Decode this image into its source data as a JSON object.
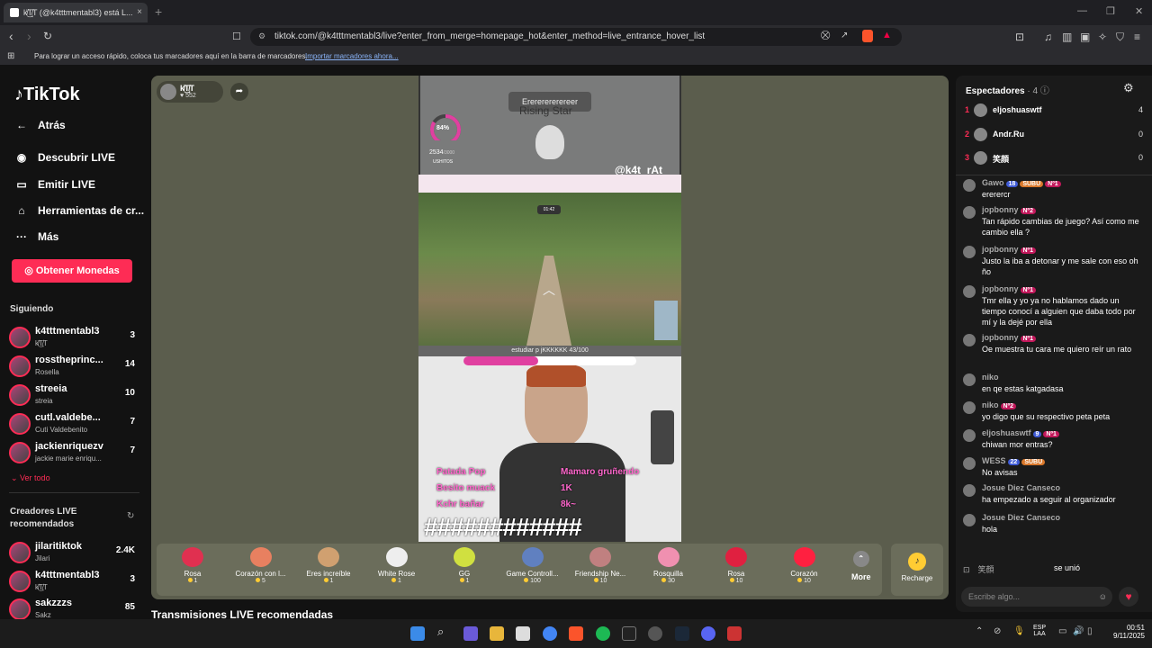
{
  "browser": {
    "tab_title": "k̸̈͜T̸͙T (@k4tttmentabl3) está L...",
    "tab_close": "×",
    "new_tab": "+",
    "url": "tiktok.com/@k4tttmentabl3/live?enter_from_merge=homepage_hot&enter_method=live_entrance_hover_list",
    "bookmarks_text": "Para lograr un acceso rápido, coloca tus marcadores aquí en la barra de marcadores.",
    "bookmarks_link": "Importar marcadores ahora..."
  },
  "sidebar": {
    "logo": "TikTok",
    "back": "Atrás",
    "nav": [
      {
        "label": "Descubrir LIVE",
        "icon": "live-discover-icon"
      },
      {
        "label": "Emitir LIVE",
        "icon": "camera-icon"
      },
      {
        "label": "Herramientas de cr...",
        "icon": "home-icon"
      },
      {
        "label": "Más",
        "icon": "more-dots-icon"
      }
    ],
    "coins_button": "Obtener Monedas",
    "following_title": "Siguiendo",
    "following": [
      {
        "name": "k4tttmentabl3",
        "sub": "k̸̈͜T̸͙T",
        "count": "3"
      },
      {
        "name": "rosstheprinc...",
        "sub": "Rosella",
        "count": "14"
      },
      {
        "name": "streeia",
        "sub": "streia",
        "count": "10"
      },
      {
        "name": "cutl.valdebe...",
        "sub": "Cuti Valdebenito",
        "count": "7"
      },
      {
        "name": "jackienriquezv",
        "sub": "jackie marie enriqu...",
        "count": "7"
      }
    ],
    "see_all": "Ver todo",
    "recommended_title": "Creadores LIVE recomendados",
    "recommended": [
      {
        "name": "jilaritiktok",
        "sub": "Jilari",
        "count": "2.4K"
      },
      {
        "name": "k4tttmentabl3",
        "sub": "k̸̈͜T̸͙T",
        "count": "3"
      },
      {
        "name": "sakzzzs",
        "sub": "Sakz",
        "count": "85"
      }
    ]
  },
  "stage": {
    "streamer_name": "k̸̈͜T̸͙T",
    "streamer_likes": "552",
    "overlay": {
      "banner_text": "Erererererereer",
      "banner_sub": "Rising Star",
      "gauge_percent": "84%",
      "gauge_count": "2534",
      "gauge_total": "/3000",
      "gauge_label": "USHITOS",
      "handle": "@k4t_rAt",
      "map_time": "01:42",
      "goal_text": "estudiar p jKKKKKK 43/100",
      "goal_percent": "43%",
      "goal_progress": 0.43,
      "gauge_progress": 0.84,
      "actions": [
        "Patada Pop",
        "Besito muack",
        "Kchr bañar",
        "Mamaro gruñendo",
        "1K",
        "8k~"
      ],
      "hashes": "############"
    },
    "gifts": [
      {
        "name": "Rosa",
        "price": "1",
        "color": "#e03050"
      },
      {
        "name": "Corazón con l...",
        "price": "5",
        "color": "#e88060"
      },
      {
        "name": "Eres increíble",
        "price": "1",
        "color": "#d0a070"
      },
      {
        "name": "White Rose",
        "price": "1",
        "color": "#eeeeee"
      },
      {
        "name": "GG",
        "price": "1",
        "color": "#d0e040"
      },
      {
        "name": "Game Controll...",
        "price": "100",
        "color": "#6080c0"
      },
      {
        "name": "Friendship Ne...",
        "price": "10",
        "color": "#c08080"
      },
      {
        "name": "Rosquilla",
        "price": "30",
        "color": "#f090b0"
      },
      {
        "name": "Rosa",
        "price": "10",
        "color": "#e02040"
      },
      {
        "name": "Corazón",
        "price": "10",
        "color": "#ff2040"
      }
    ],
    "more": "More",
    "recharge": "Recharge",
    "recommended_title": "Transmisiones LIVE recomendadas"
  },
  "panel": {
    "viewers_title": "Espectadores",
    "viewers_count": "4",
    "viewers": [
      {
        "rank": "1",
        "name": "eljoshuaswtf",
        "score": "4"
      },
      {
        "rank": "2",
        "name": "Andr.Ru",
        "score": "0"
      },
      {
        "rank": "3",
        "name": "笑顔",
        "score": "0"
      }
    ],
    "messages": [
      {
        "user": "Gawo",
        "badges": [
          "18",
          "SUBU",
          "Nº1"
        ],
        "text": "ererercr"
      },
      {
        "user": "jopbonny",
        "badges": [
          "Nº2"
        ],
        "text": "Tan rápido cambias de juego? Así como me cambio ella ?"
      },
      {
        "user": "jopbonny",
        "badges": [
          "Nº1"
        ],
        "text": "Justo la iba a detonar y me sale con eso oh ño"
      },
      {
        "user": "jopbonny",
        "badges": [
          "Nº1"
        ],
        "text": "Tmr ella y yo ya no hablamos dado un tiempo conocí a alguien que daba todo por mí y la dejé por ella"
      },
      {
        "user": "jopbonny",
        "badges": [
          "Nº1"
        ],
        "text": "Oe muestra tu cara me quiero reír un rato"
      },
      {
        "user": "niko",
        "badges": [],
        "text": "en qe estas katgadasa"
      },
      {
        "user": "niko",
        "badges": [
          "Nº2"
        ],
        "text": "yo digo que su respectivo peta peta"
      },
      {
        "user": "eljoshuaswtf",
        "badges": [
          "9",
          "Nº1"
        ],
        "text": "chiwan mor entras?"
      },
      {
        "user": "WESS",
        "badges": [
          "22",
          "SUBU"
        ],
        "text": "No avisas"
      },
      {
        "user": "Josue Diez Canseco",
        "badges": [],
        "text": "ha empezado a seguir al organizador"
      },
      {
        "user": "Josue Diez Canseco",
        "badges": [],
        "text": "hola"
      }
    ],
    "join_user": "笑顔",
    "join_text": "se unió",
    "input_placeholder": "Escribe algo..."
  },
  "taskbar": {
    "lang_top": "ESP",
    "lang_bottom": "LAA",
    "time": "00:51",
    "date": "9/11/2025"
  }
}
